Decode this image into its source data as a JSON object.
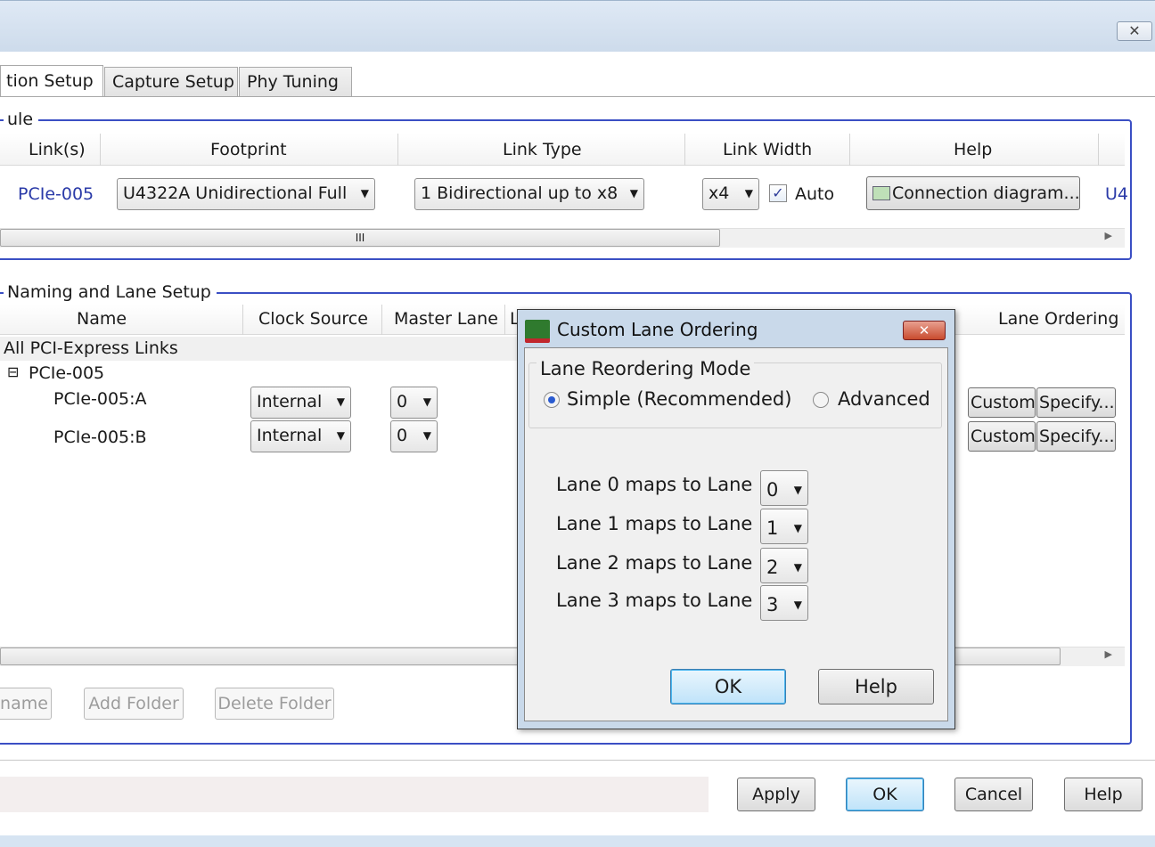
{
  "window": {
    "close_glyph": "✕"
  },
  "tabs": [
    {
      "label": "tion Setup",
      "active": true
    },
    {
      "label": "Capture Setup",
      "active": false
    },
    {
      "label": "Phy Tuning",
      "active": false
    }
  ],
  "module_group": {
    "legend": "ule",
    "columns": [
      "Link(s)",
      "Footprint",
      "Link Type",
      "Link Width",
      "Help"
    ],
    "row": {
      "link": "PCIe-005",
      "footprint": "U4322A Unidirectional Full",
      "link_type": "1 Bidirectional up to x8",
      "link_width": "x4",
      "auto_label": "Auto",
      "auto_checked": true,
      "help_button": "Connection diagram...",
      "overflow_text": "U4"
    },
    "scroll_grip": "III"
  },
  "naming_group": {
    "legend": "Naming and Lane Setup",
    "columns": [
      "Name",
      "Clock Source",
      "Master Lane",
      "L",
      "Lane Ordering"
    ],
    "root": "All PCI-Express Links",
    "folder": {
      "expander": "⊟",
      "label": "PCIe-005"
    },
    "rows": [
      {
        "name": "PCIe-005:A",
        "clock": "Internal",
        "master": "0",
        "custom": "Custom",
        "specify": "Specify..."
      },
      {
        "name": "PCIe-005:B",
        "clock": "Internal",
        "master": "0",
        "custom": "Custom",
        "specify": "Specify..."
      }
    ],
    "buttons": {
      "rename": "name",
      "add_folder": "Add Folder",
      "delete_folder": "Delete Folder"
    }
  },
  "footer": {
    "apply": "Apply",
    "ok": "OK",
    "cancel": "Cancel",
    "help": "Help"
  },
  "dialog": {
    "title": "Custom Lane Ordering",
    "close_glyph": "✕",
    "mode_legend": "Lane Reordering Mode",
    "mode_simple": "Simple (Recommended)",
    "mode_advanced": "Advanced",
    "selected_mode": "simple",
    "mappings": [
      {
        "label": "Lane 0 maps to Lane",
        "value": "0"
      },
      {
        "label": "Lane 1 maps to Lane",
        "value": "1"
      },
      {
        "label": "Lane 2 maps to Lane",
        "value": "2"
      },
      {
        "label": "Lane 3 maps to Lane",
        "value": "3"
      }
    ],
    "ok": "OK",
    "help": "Help"
  },
  "icons": {
    "dropdown": "chevron-down-icon",
    "scroll_right": "scroll-right-icon",
    "expander": "collapse-icon",
    "window_close": "close-icon",
    "dialog_app": "app-icon",
    "help": "diagram-icon"
  },
  "colors": {
    "group_border": "#3b4fc4",
    "link_text": "#2a3aa8",
    "dialog_frame": "#c9d9ea",
    "close_red": "#c94b2e"
  }
}
